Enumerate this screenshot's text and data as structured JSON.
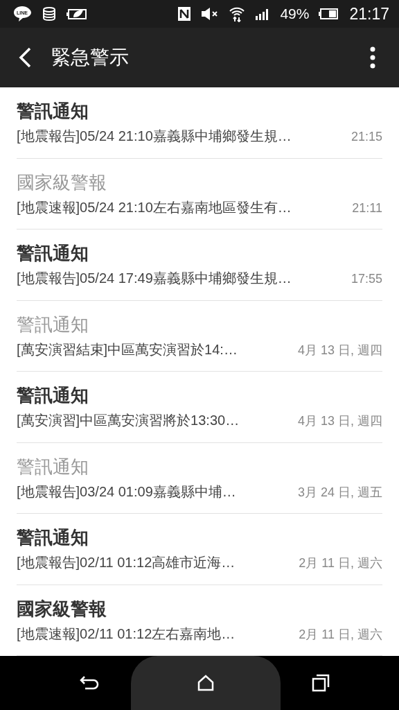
{
  "status_bar": {
    "app_badge": "LINE",
    "battery": "49%",
    "time": "21:17"
  },
  "app_bar": {
    "title": "緊急警示"
  },
  "alerts": [
    {
      "title": "警訊通知",
      "message": "[地震報告]05/24 21:10嘉義縣中埔鄉發生規…",
      "time": "21:15",
      "unread": true
    },
    {
      "title": "國家級警報",
      "message": "[地震速報]05/24 21:10左右嘉南地區發生有…",
      "time": "21:11",
      "unread": false
    },
    {
      "title": "警訊通知",
      "message": "[地震報告]05/24 17:49嘉義縣中埔鄉發生規…",
      "time": "17:55",
      "unread": true
    },
    {
      "title": "警訊通知",
      "message": "[萬安演習結束]中區萬安演習於14:…",
      "time": "4月 13 日, 週四",
      "unread": false
    },
    {
      "title": "警訊通知",
      "message": "[萬安演習]中區萬安演習將於13:30…",
      "time": "4月 13 日, 週四",
      "unread": true
    },
    {
      "title": "警訊通知",
      "message": "[地震報告]03/24 01:09嘉義縣中埔…",
      "time": "3月 24 日, 週五",
      "unread": false
    },
    {
      "title": "警訊通知",
      "message": "[地震報告]02/11 01:12高雄市近海…",
      "time": "2月 11 日, 週六",
      "unread": true
    },
    {
      "title": "國家級警報",
      "message": "[地震速報]02/11 01:12左右嘉南地…",
      "time": "2月 11 日, 週六",
      "unread": true
    }
  ]
}
